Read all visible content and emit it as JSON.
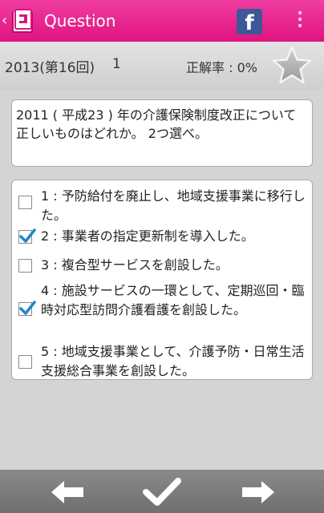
{
  "appbar": {
    "title": "Question",
    "icons": [
      "back-chevron-icon",
      "app-icon",
      "facebook-icon",
      "overflow-menu-icon"
    ],
    "facebook_glyph": "f",
    "back_glyph": "‹",
    "color": "#e91e8c"
  },
  "infobar": {
    "year": "2013(第16回)",
    "question_number": "1",
    "correct_rate": "正解率 : 0%",
    "favorite_icon": "star-icon"
  },
  "question": {
    "text": "2011 ( 平成23 ) 年の介護保険制度改正について正しいものはどれか。 2つ選べ。"
  },
  "options": [
    {
      "label": "1 : 予防給付を廃止し、地域支援事業に移行した。",
      "checked": false
    },
    {
      "label": "2 : 事業者の指定更新制を導入した。",
      "checked": true
    },
    {
      "label": "3 : 複合型サービスを創設した。",
      "checked": false
    },
    {
      "label": "4 : 施設サービスの一環として、定期巡回・臨時対応型訪問介護看護を創設した。",
      "checked": true
    },
    {
      "label": "5 : 地域支援事業として、介護予防・日常生活支援総合事業を創設した。",
      "checked": false
    }
  ],
  "bottombar": {
    "icons": [
      "arrow-left-icon",
      "checkmark-icon",
      "arrow-right-icon"
    ]
  },
  "colors": {
    "accent": "#e91e8c",
    "check": "#1e88c8",
    "facebook": "#3b5998"
  }
}
